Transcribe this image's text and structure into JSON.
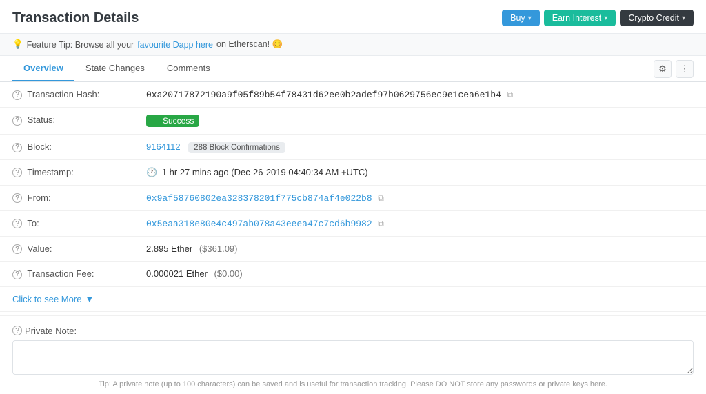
{
  "header": {
    "title": "Transaction Details",
    "buttons": [
      {
        "label": "Buy",
        "type": "blue",
        "id": "buy"
      },
      {
        "label": "Earn Interest",
        "type": "teal",
        "id": "earn-interest"
      },
      {
        "label": "Crypto Credit",
        "type": "dark",
        "id": "crypto-credit"
      }
    ]
  },
  "feature_tip": {
    "prefix": "Feature Tip: Browse all your ",
    "link_text": "favourite Dapp here",
    "suffix": " on Etherscan! 😊"
  },
  "tabs": {
    "items": [
      {
        "label": "Overview",
        "active": true
      },
      {
        "label": "State Changes",
        "active": false
      },
      {
        "label": "Comments",
        "active": false
      }
    ]
  },
  "fields": {
    "transaction_hash": {
      "label": "Transaction Hash:",
      "value": "0xa20717872190a9f05f89b54f78431d62ee0b2adef97b0629756ec9e1cea6e1b4"
    },
    "status": {
      "label": "Status:",
      "value": "Success"
    },
    "block": {
      "label": "Block:",
      "block_number": "9164112",
      "confirmations": "288 Block Confirmations"
    },
    "timestamp": {
      "label": "Timestamp:",
      "value": "1 hr 27 mins ago (Dec-26-2019 04:40:34 AM +UTC)"
    },
    "from": {
      "label": "From:",
      "value": "0x9af58760802ea328378201f775cb874af4e022b8"
    },
    "to": {
      "label": "To:",
      "value": "0x5eaa318e80e4c497ab078a43eeea47c7cd6b9982"
    },
    "value": {
      "label": "Value:",
      "ether": "2.895 Ether",
      "usd": "($361.09)"
    },
    "transaction_fee": {
      "label": "Transaction Fee:",
      "ether": "0.000021 Ether",
      "usd": "($0.00)"
    }
  },
  "see_more": {
    "label": "Click to see More"
  },
  "private_note": {
    "label": "Private Note:",
    "placeholder": "",
    "tip": "Tip: A private note (up to 100 characters) can be saved and is useful for transaction tracking. Please DO NOT store any passwords or private keys here."
  }
}
